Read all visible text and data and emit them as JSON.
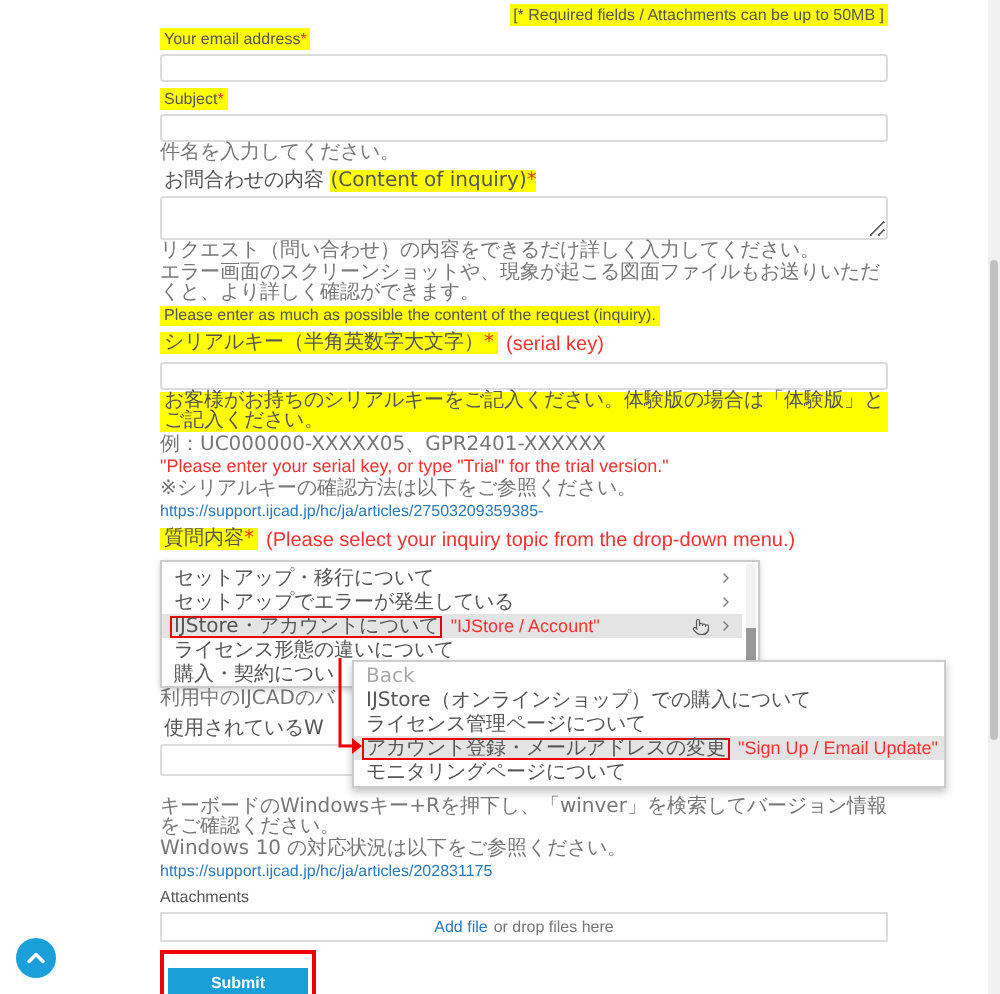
{
  "required_note": "[* Required fields / Attachments can be up to 50MB ]",
  "email": {
    "label": "Your email address",
    "mark": "*"
  },
  "subject": {
    "label": "Subject",
    "mark": "*",
    "hint": "件名を入力してください。"
  },
  "content": {
    "label": "お問合わせの内容",
    "label_highlight": "(Content of inquiry)",
    "mark": "*",
    "hints": [
      "リクエスト（問い合わせ）の内容をできるだけ詳しく入力してください。",
      "エラー画面のスクリーンショットや、現象が起こる図面ファイルもお送りいただくと、より詳しく確認ができます。"
    ],
    "note": "Please enter as much as possible the content of the request (inquiry)."
  },
  "serial": {
    "label": "シリアルキー（半角英数字大文字）",
    "mark": "*",
    "annotation": "(serial key)",
    "note": "お客様がお持ちのシリアルキーをご記入ください。体験版の場合は「体験版」とご記入ください。",
    "example": "例：UC000000-XXXXX05、GPR2401-XXXXXX",
    "example_annotation": "\"Please enter your serial key, or type \"Trial\" for the trial version.\"",
    "help": "※シリアルキーの確認方法は以下をご参照ください。",
    "link": "https://support.ijcad.jp/hc/ja/articles/27503209359385-"
  },
  "topic": {
    "label": "質問内容",
    "mark": "*",
    "annotation": "(Please select your inquiry topic from the drop-down menu.)",
    "menu": [
      {
        "label": "セットアップ・移行について",
        "selected": false,
        "submenu": true
      },
      {
        "label": "セットアップでエラーが発生している",
        "selected": false,
        "submenu": true
      },
      {
        "label": "IJStore・アカウントについて",
        "selected": true,
        "submenu": true,
        "annotation": "\"IJStore / Account\""
      },
      {
        "label": "ライセンス形態の違いについて",
        "selected": false,
        "submenu": false
      },
      {
        "label": "購入・契約につい",
        "selected": false
      }
    ],
    "submenu": [
      {
        "label": "Back",
        "selected": false,
        "disabled": true
      },
      {
        "label": "IJStore（オンラインショップ）での購入について",
        "selected": false,
        "disabled": false
      },
      {
        "label": "ライセンス管理ページについて",
        "selected": false,
        "disabled": false
      },
      {
        "label": "アカウント登録・メールアドレスの変更",
        "selected": true,
        "disabled": false,
        "annotation": "\"Sign Up / Email Update\""
      },
      {
        "label": "モニタリングページについて",
        "selected": false,
        "disabled": false
      }
    ]
  },
  "version": {
    "hint": "利用中のIJCADのバ",
    "label": "使用されているW",
    "hints": [
      "キーボードのWindowsキー+Rを押下し、「winver」を検索してバージョン情報をご確認ください。",
      "Windows 10 の対応状況は以下をご参照ください。"
    ],
    "link": "https://support.ijcad.jp/hc/ja/articles/202831175"
  },
  "attachments": {
    "label": "Attachments",
    "link": "Add file",
    "text": "or drop files here"
  },
  "submit": "Submit"
}
